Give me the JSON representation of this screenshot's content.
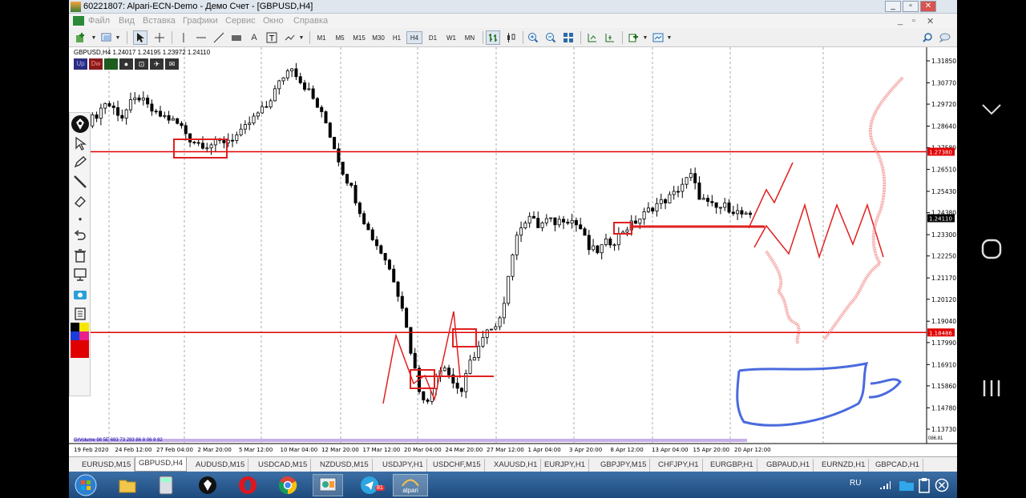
{
  "window": {
    "title": "60221807: Alpari-ECN-Demo - Демо Счет - [GBPUSD,H4]"
  },
  "menu": [
    "Файл",
    "Вид",
    "Вставка",
    "Графики",
    "Сервис",
    "Окно",
    "Справка"
  ],
  "timeframes": [
    "M1",
    "M5",
    "M15",
    "M30",
    "H1",
    "H4",
    "D1",
    "W1",
    "MN"
  ],
  "active_timeframe": "H4",
  "chart": {
    "header": "GBPUSD,H4  1.24017 1.24195 1.23972 1.24110",
    "indicator_label": "GrVolume 98 5E 693 73 293 86 8 06 8 82",
    "indicator_right": "086.81"
  },
  "chart_data": {
    "type": "candlestick",
    "symbol": "GBPUSD",
    "timeframe": "H4",
    "x_labels": [
      "19 Feb 2020",
      "24 Feb 12:00",
      "27 Feb 04:00",
      "2 Mar 20:00",
      "5 Mar 12:00",
      "10 Mar 04:00",
      "12 Mar 20:00",
      "17 Mar 12:00",
      "20 Mar 04:00",
      "24 Mar 20:00",
      "27 Mar 12:00",
      "1 Apr 04:00",
      "3 Apr 20:00",
      "8 Apr 12:00",
      "13 Apr 04:00",
      "15 Apr 20:00",
      "20 Apr 12:00"
    ],
    "y_ticks": [
      "1.31850",
      "1.30770",
      "1.29720",
      "1.28640",
      "1.27580",
      "1.26510",
      "1.25430",
      "1.24380",
      "1.23300",
      "1.22250",
      "1.21170",
      "1.20120",
      "1.19040",
      "1.17990",
      "1.16910",
      "1.15860",
      "1.14780",
      "1.13730"
    ],
    "ylim": [
      1.1373,
      1.3185
    ],
    "price_line": "1.24110",
    "levels": [
      {
        "price": 1.2738,
        "label": "1.27380",
        "color": "#e00000"
      },
      {
        "price": 1.18486,
        "label": "1.18486",
        "color": "#e00000"
      }
    ],
    "close_path": [
      [
        0,
        1.2885
      ],
      [
        2,
        1.292
      ],
      [
        4,
        1.298
      ],
      [
        6,
        1.295
      ],
      [
        8,
        1.291
      ],
      [
        10,
        1.2975
      ],
      [
        12,
        1.3005
      ],
      [
        14,
        1.296
      ],
      [
        16,
        1.292
      ],
      [
        18,
        1.291
      ],
      [
        20,
        1.289
      ],
      [
        22,
        1.286
      ],
      [
        24,
        1.28
      ],
      [
        26,
        1.278
      ],
      [
        28,
        1.277
      ],
      [
        30,
        1.278
      ],
      [
        32,
        1.279
      ],
      [
        34,
        1.2805
      ],
      [
        36,
        1.283
      ],
      [
        38,
        1.288
      ],
      [
        40,
        1.2925
      ],
      [
        42,
        1.296
      ],
      [
        44,
        1.304
      ],
      [
        46,
        1.311
      ],
      [
        48,
        1.316
      ],
      [
        50,
        1.3085
      ],
      [
        52,
        1.3035
      ],
      [
        54,
        1.296
      ],
      [
        56,
        1.288
      ],
      [
        58,
        1.276
      ],
      [
        60,
        1.264
      ],
      [
        62,
        1.256
      ],
      [
        64,
        1.245
      ],
      [
        66,
        1.235
      ],
      [
        68,
        1.228
      ],
      [
        70,
        1.221
      ],
      [
        72,
        1.211
      ],
      [
        74,
        1.198
      ],
      [
        76,
        1.176
      ],
      [
        78,
        1.157
      ],
      [
        80,
        1.15
      ],
      [
        82,
        1.165
      ],
      [
        84,
        1.169
      ],
      [
        86,
        1.16
      ],
      [
        88,
        1.156
      ],
      [
        90,
        1.17
      ],
      [
        92,
        1.178
      ],
      [
        94,
        1.185
      ],
      [
        96,
        1.186
      ],
      [
        98,
        1.201
      ],
      [
        100,
        1.224
      ],
      [
        102,
        1.238
      ],
      [
        104,
        1.242
      ],
      [
        106,
        1.237
      ],
      [
        108,
        1.24
      ],
      [
        110,
        1.239
      ],
      [
        112,
        1.241
      ],
      [
        114,
        1.24
      ],
      [
        116,
        1.236
      ],
      [
        118,
        1.226
      ],
      [
        120,
        1.225
      ],
      [
        122,
        1.229
      ],
      [
        124,
        1.23
      ],
      [
        126,
        1.235
      ],
      [
        128,
        1.238
      ],
      [
        130,
        1.241
      ],
      [
        132,
        1.245
      ],
      [
        134,
        1.248
      ],
      [
        136,
        1.25
      ],
      [
        138,
        1.253
      ],
      [
        140,
        1.258
      ],
      [
        142,
        1.262
      ],
      [
        144,
        1.252
      ],
      [
        146,
        1.248
      ],
      [
        148,
        1.246
      ],
      [
        150,
        1.247
      ],
      [
        152,
        1.245
      ],
      [
        154,
        1.243
      ],
      [
        156,
        1.2411
      ]
    ]
  },
  "tabs": [
    "EURUSD,M15",
    "GBPUSD,H4",
    "AUDUSD,M15",
    "USDCAD,M15",
    "NZDUSD,M15",
    "USDJPY,H1",
    "USDCHF,M15",
    "XAUUSD,H1",
    "EURJPY,H1",
    "GBPJPY,M15",
    "CHFJPY,H1",
    "EURGBP,H1",
    "GBPAUD,H1",
    "EURNZD,H1",
    "GBPCAD,H1"
  ],
  "active_tab": "GBPUSD,H4",
  "chart_buttons": [
    "Up",
    "Dw"
  ],
  "taskbar": {
    "lang": "RU",
    "alpari_label": "alpari",
    "badge": "81"
  },
  "colors": {
    "level_line": "#e00000",
    "annotation_red": "#e02020",
    "annotation_blue": "#2a50d8",
    "candles": "#000000"
  }
}
